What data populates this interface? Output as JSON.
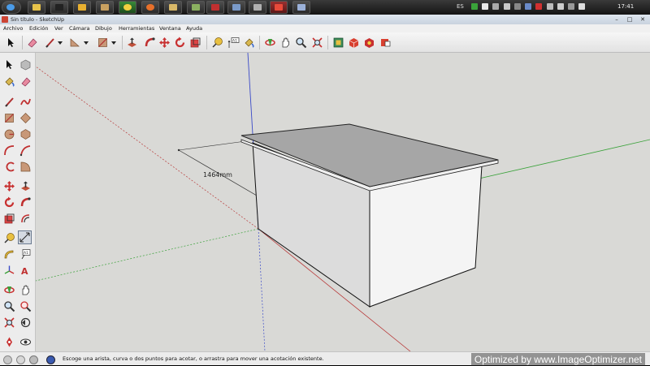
{
  "window": {
    "title": "Sin título - SketchUp"
  },
  "taskbar": {
    "language": "ES",
    "clock": "17:41"
  },
  "menu": {
    "items": [
      "Archivo",
      "Edición",
      "Ver",
      "Cámara",
      "Dibujo",
      "Herramientas",
      "Ventana",
      "Ayuda"
    ]
  },
  "viewport": {
    "dimension_label": "1464mm"
  },
  "status": {
    "message": "Escoge una arista, curva o dos puntos para acotar, o arrastra para mover una acotación existente."
  },
  "watermark": {
    "text": "Optimized by www.ImageOptimizer.net"
  },
  "colors": {
    "viewport_bg": "#d9d9d6",
    "axis_red": "#b83a3a",
    "axis_green": "#3aa23a",
    "axis_blue": "#3a4ac8",
    "table_top": "#a6a6a6",
    "front_face": "#f4f4f4",
    "side_face": "#dcdcdc"
  }
}
